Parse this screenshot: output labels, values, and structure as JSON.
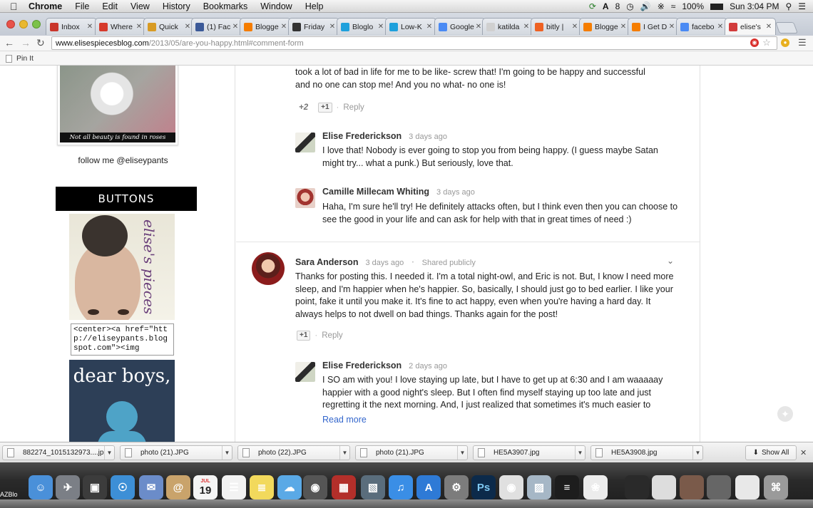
{
  "menubar": {
    "app": "Chrome",
    "items": [
      "File",
      "Edit",
      "View",
      "History",
      "Bookmarks",
      "Window",
      "Help"
    ],
    "adobe_count": "8",
    "battery": "100%",
    "clock": "Sun 3:04 PM"
  },
  "tabs": [
    {
      "label": "Inbox",
      "icon": "gmail-icon",
      "color": "#c9352b"
    },
    {
      "label": "Where",
      "icon": "sparknotes-icon",
      "color": "#d63a2c"
    },
    {
      "label": "Quick",
      "icon": "drop-icon",
      "color": "#d89b24"
    },
    {
      "label": "(1) Fac",
      "icon": "facebook-icon",
      "color": "#3b5998"
    },
    {
      "label": "Blogge",
      "icon": "blogger-icon",
      "color": "#f57d00"
    },
    {
      "label": "Friday",
      "icon": "photo-icon",
      "color": "#333333"
    },
    {
      "label": "Bloglo",
      "icon": "bloglovin-icon",
      "color": "#1ea0dc"
    },
    {
      "label": "Low-K",
      "icon": "bloglovin-icon",
      "color": "#1ea0dc"
    },
    {
      "label": "Google",
      "icon": "google-icon",
      "color": "#4a8af4"
    },
    {
      "label": "katilda",
      "icon": "page-icon",
      "color": "#d0d0d0"
    },
    {
      "label": "bitly |",
      "icon": "bitly-icon",
      "color": "#ee6123"
    },
    {
      "label": "Blogge",
      "icon": "blogger-icon",
      "color": "#f57d00"
    },
    {
      "label": "I Get D",
      "icon": "blogger-icon",
      "color": "#f57d00"
    },
    {
      "label": "facebo",
      "icon": "google-icon",
      "color": "#4a8af4"
    },
    {
      "label": "elise's",
      "icon": "blog-icon",
      "color": "#d23c3c"
    }
  ],
  "omnibox": {
    "host": "www.elisespiecesblog.com",
    "path": "/2013/05/are-you-happy.html#comment-form"
  },
  "bookmarks": [
    "Pin It"
  ],
  "sidebar": {
    "photo_caption": "Not all beauty is found in roses",
    "follow": "follow me @eliseypants",
    "buttons_header": "BUTTONS",
    "pieces_script": "elise's pieces",
    "code_snippet": "<center><a href=\"http://eliseypants.blogspot.com\"><img",
    "dear_boys": "dear boys,"
  },
  "comments": {
    "top_text_line1": "took a lot of bad in life for me to be like- screw that!  I'm going to be happy and successful",
    "top_text_line2": "and no one can stop me!  And you no what- no one is!",
    "top_plus": "+2",
    "plus_one": "+1",
    "reply": "Reply",
    "r1_author": "Elise Frederickson",
    "r1_time": "3 days ago",
    "r1_text": "I love that! Nobody is ever going to stop you from being happy. (I guess maybe Satan might try... what a punk.) But seriously, love that.",
    "r2_author": "Camille Millecam Whiting",
    "r2_time": "3 days ago",
    "r2_text": "Haha, I'm sure he'll try!  He definitely attacks often, but I think even then you can choose to see the good in your life and can ask for help with that in great times of need :)",
    "c2_author": "Sara Anderson",
    "c2_time": "3 days ago",
    "c2_shared": "Shared publicly",
    "c2_text": "Thanks for posting this. I needed it. I'm a total night-owl, and Eric is not. But, I know I need more sleep, and I'm happier when he's happier. So, basically, I should just go to bed earlier.  I like your point, fake it until you make it. It's fine to act happy, even when you're having a hard day. It always helps to not dwell on bad things. Thanks again for the post!",
    "r3_author": "Elise Frederickson",
    "r3_time": "2 days ago",
    "r3_text": "I SO am with you! I love staying up late, but I have to get up at 6:30 and I am waaaaay happier with a good night's sleep. But I often find myself staying up too late and just regretting it the next morning. And, I just realized that sometimes it's much easier to",
    "read_more": "Read more"
  },
  "downloads": [
    "882274_1015132973....jpg",
    "photo (21).JPG",
    "photo (22).JPG",
    "photo (21).JPG",
    "HE5A3907.jpg",
    "HE5A3908.jpg"
  ],
  "show_all": "Show All",
  "dock": {
    "label": "AZBlo",
    "calendar_day": "19",
    "photoshop": "Ps",
    "ical_month": "JUL"
  }
}
